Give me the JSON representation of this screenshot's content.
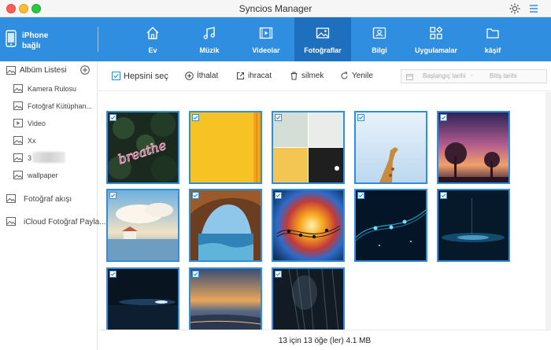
{
  "window": {
    "title": "Syncios Manager"
  },
  "device": {
    "name": "iPhone",
    "status": "bağlı"
  },
  "tabs": [
    {
      "label": "Ev",
      "icon": "home-icon"
    },
    {
      "label": "Müzik",
      "icon": "music-icon"
    },
    {
      "label": "Videolar",
      "icon": "video-icon"
    },
    {
      "label": "Fotoğraflar",
      "icon": "photo-icon",
      "active": true
    },
    {
      "label": "Bilgi",
      "icon": "contact-card-icon"
    },
    {
      "label": "Uygulamalar",
      "icon": "apps-icon"
    },
    {
      "label": "kâşif",
      "icon": "folder-icon"
    }
  ],
  "sidebar": {
    "album_header": "Albüm Listesi",
    "albums": [
      {
        "label": "Kamera Rulosu",
        "icon": "album-icon"
      },
      {
        "label": "Fotoğraf Kütüphan...",
        "icon": "album-icon"
      },
      {
        "label": "Video",
        "icon": "video-album-icon"
      },
      {
        "label": "Xx",
        "icon": "album-icon"
      },
      {
        "label": "3",
        "icon": "album-icon"
      },
      {
        "label": "wallpaper",
        "icon": "album-icon"
      }
    ],
    "groups": [
      {
        "label": "Fotoğraf akışı",
        "icon": "photostream-icon"
      },
      {
        "label": "iCloud Fotoğraf Payla...",
        "icon": "icloud-share-icon"
      }
    ]
  },
  "toolbar": {
    "select_all": "Hepsini seç",
    "import": "İthalat",
    "export": "ihracat",
    "delete": "silmek",
    "refresh": "Yenile",
    "start_date_placeholder": "Başlangıç tarihi",
    "separator": "-",
    "end_date_placeholder": "Bitiş tarihi"
  },
  "photos": [
    {
      "subject": "breathe neon sign",
      "checked": true
    },
    {
      "subject": "yellow wall",
      "checked": true
    },
    {
      "subject": "color blocks",
      "checked": true
    },
    {
      "subject": "giraffe sky",
      "checked": true
    },
    {
      "subject": "sunset trees",
      "checked": true
    },
    {
      "subject": "house by the sea",
      "checked": true
    },
    {
      "subject": "sea cave",
      "checked": true
    },
    {
      "subject": "music notes",
      "checked": true
    },
    {
      "subject": "blue music notes",
      "checked": true
    },
    {
      "subject": "blue particles",
      "checked": true
    },
    {
      "subject": "dark horizon",
      "checked": true
    },
    {
      "subject": "sunset beach",
      "checked": true
    },
    {
      "subject": "rain streaks",
      "checked": true
    }
  ],
  "status": {
    "text": "13 için 13 öğe (ler) 4.1 MB"
  },
  "colors": {
    "accent": "#2f8ee0",
    "active_tab": "#1e6fbd"
  }
}
